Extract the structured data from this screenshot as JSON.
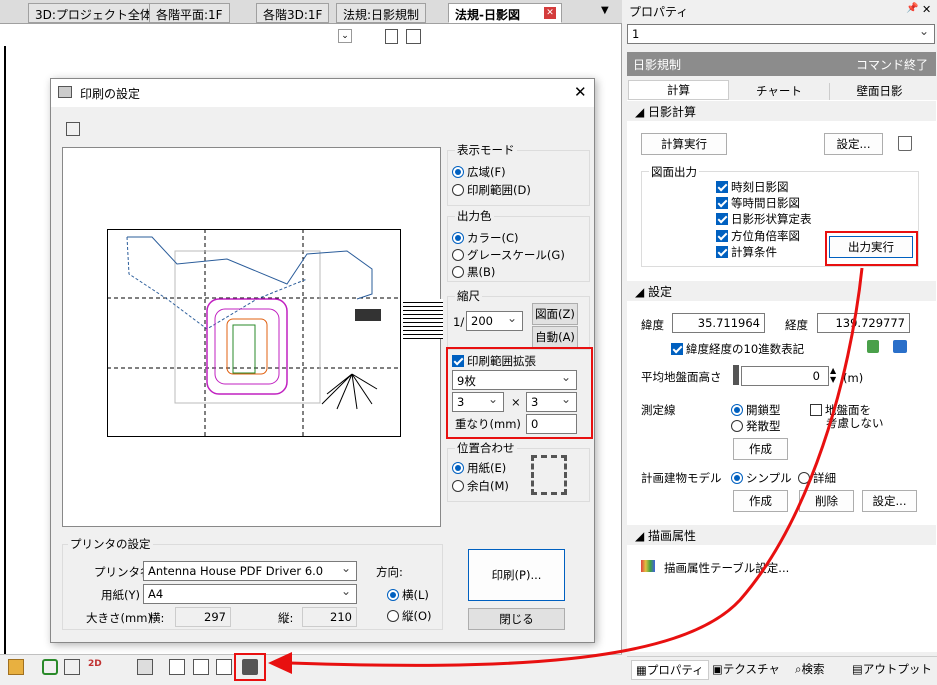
{
  "tabs": [
    "3D:プロジェクト全体",
    "各階平面:1F",
    "各階3D:1F",
    "法規:日影規制",
    "法規-日影図"
  ],
  "props": {
    "title": "プロパティ",
    "pin": "ᵖ",
    "close": "✕",
    "combo": "1",
    "header": "日影規制",
    "header_right": "コマンド終了",
    "tabs": [
      "計算",
      "チャート",
      "壁面日影"
    ],
    "s1": "日影計算",
    "calc_btn": "計算実行",
    "settings_btn": "設定...",
    "out_group": "図面出力",
    "outs": [
      "時刻日影図",
      "等時間日影図",
      "日影形状算定表",
      "方位角倍率図",
      "計算条件"
    ],
    "out_btn": "出力実行",
    "s2": "設定",
    "lat_label": "緯度",
    "lat": "35.711964",
    "lon_label": "経度",
    "lon": "139.729777",
    "decimal": "緯度経度の10進数表記",
    "avg_label": "平均地盤面高さ",
    "avg_val": "0",
    "unit": "(m)",
    "mline": "測定線",
    "closed": "開鎖型",
    "open": "発散型",
    "ground": "地盤面を",
    "consider": "考慮しない",
    "make": "作成",
    "model": "計画建物モデル",
    "simple": "シンプル",
    "detail": "詳細",
    "make2": "作成",
    "delete": "削除",
    "settings2": "設定...",
    "s3": "描画属性",
    "draw_item": "描画属性テーブル設定...",
    "bottom_tabs": [
      "プロパティ",
      "テクスチャ",
      "検索",
      "アウトプット"
    ]
  },
  "dialog": {
    "title": "印刷の設定",
    "close": "✕",
    "mode_title": "表示モード",
    "wide": "広域(F)",
    "range": "印刷範囲(D)",
    "color_title": "出力色",
    "color": "カラー(C)",
    "gray": "グレースケール(G)",
    "black": "黒(B)",
    "scale_title": "縮尺",
    "scale_prefix": "1/",
    "scale": "200",
    "fig_btn": "図面(Z)",
    "auto_btn": "自動(A)",
    "expand": "印刷範囲拡張",
    "sheets": "9枚",
    "rows": "3",
    "cols": "3",
    "times": "×",
    "overlap_label": "重なり(mm)",
    "overlap": "0",
    "align_title": "位置合わせ",
    "paper": "用紙(E)",
    "margin": "余白(M)",
    "printer_title": "プリンタの設定",
    "printer_label": "プリンタ名",
    "printer": "Antenna House PDF Driver 6.0",
    "paper_label": "用紙(Y)",
    "paper_val": "A4",
    "size_label": "大きさ(mm)",
    "w_label": "横:",
    "w": "297",
    "h_label": "縦:",
    "h": "210",
    "dir_label": "方向:",
    "landscape": "横(L)",
    "portrait": "縦(O)",
    "print_btn": "印刷(P)...",
    "close_btn": "閉じる"
  },
  "colors": {
    "accent": "#0060c0",
    "red": "#e81010"
  }
}
